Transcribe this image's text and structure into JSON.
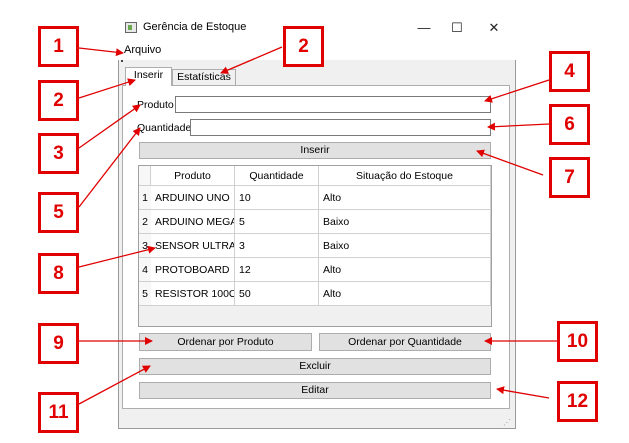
{
  "window": {
    "title": "Gerência de Estoque",
    "controls": {
      "minimize": "—",
      "maximize": "☐",
      "close": "✕"
    },
    "menu": {
      "file": "Arquivo"
    }
  },
  "tabs": [
    {
      "label": "Inserir",
      "active": true
    },
    {
      "label": "Estatísticas",
      "active": false
    }
  ],
  "form": {
    "produto_label": "Produto",
    "produto_value": "",
    "quantidade_label": "Quantidade",
    "quantidade_value": "",
    "insert_button": "Inserir"
  },
  "table": {
    "headers": [
      "Produto",
      "Quantidade",
      "Situação do Estoque"
    ],
    "rows": [
      {
        "index": "1",
        "produto": "ARDUINO UNO",
        "quantidade": "10",
        "situacao": "Alto"
      },
      {
        "index": "2",
        "produto": "ARDUINO MEGA",
        "quantidade": "5",
        "situacao": "Baixo"
      },
      {
        "index": "3",
        "produto": "SENSOR ULTRA...",
        "quantidade": "3",
        "situacao": "Baixo"
      },
      {
        "index": "4",
        "produto": "PROTOBOARD",
        "quantidade": "12",
        "situacao": "Alto"
      },
      {
        "index": "5",
        "produto": "RESISTOR 100O...",
        "quantidade": "50",
        "situacao": "Alto"
      }
    ]
  },
  "buttons": {
    "sort_product": "Ordenar por Produto",
    "sort_quantity": "Ordenar por Quantidade",
    "delete": "Excluir",
    "edit": "Editar"
  },
  "annotations": {
    "color": "#e00000",
    "labels": [
      "1",
      "2",
      "2",
      "3",
      "4",
      "5",
      "6",
      "7",
      "8",
      "9",
      "10",
      "11",
      "12"
    ]
  },
  "colors": {
    "window_bg": "#f0f0f0",
    "button_bg": "#e1e1e1",
    "annotation": "#e00000"
  }
}
